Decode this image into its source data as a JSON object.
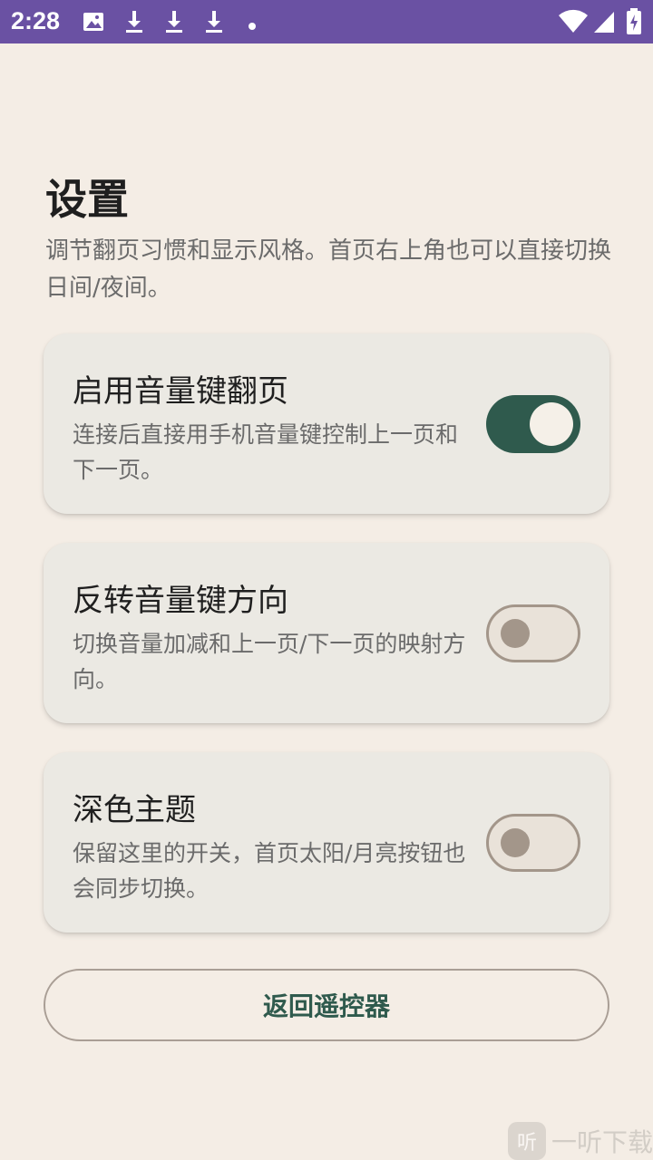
{
  "status_bar": {
    "time": "2:28",
    "icons": [
      "image-icon",
      "download-icon",
      "download-icon",
      "download-icon",
      "dot-icon",
      "wifi-icon",
      "signal-icon",
      "battery-icon"
    ]
  },
  "header": {
    "title": "设置",
    "description": "调节翻页习惯和显示风格。首页右上角也可以直接切换日间/夜间。"
  },
  "settings": [
    {
      "title": "启用音量键翻页",
      "description": "连接后直接用手机音量键控制上一页和下一页。",
      "enabled": true
    },
    {
      "title": "反转音量键方向",
      "description": "切换音量加减和上一页/下一页的映射方向。",
      "enabled": false
    },
    {
      "title": "深色主题",
      "description": "保留这里的开关，首页太阳/月亮按钮也会同步切换。",
      "enabled": false
    }
  ],
  "back_button_label": "返回遥控器",
  "watermark": {
    "logo_text": "听",
    "text": "一听下载"
  },
  "colors": {
    "status_bar": "#6a51a3",
    "background": "#f4ede5",
    "card": "#ebe9e3",
    "accent": "#2f5a4d",
    "toggle_off_outline": "#a3968a"
  }
}
